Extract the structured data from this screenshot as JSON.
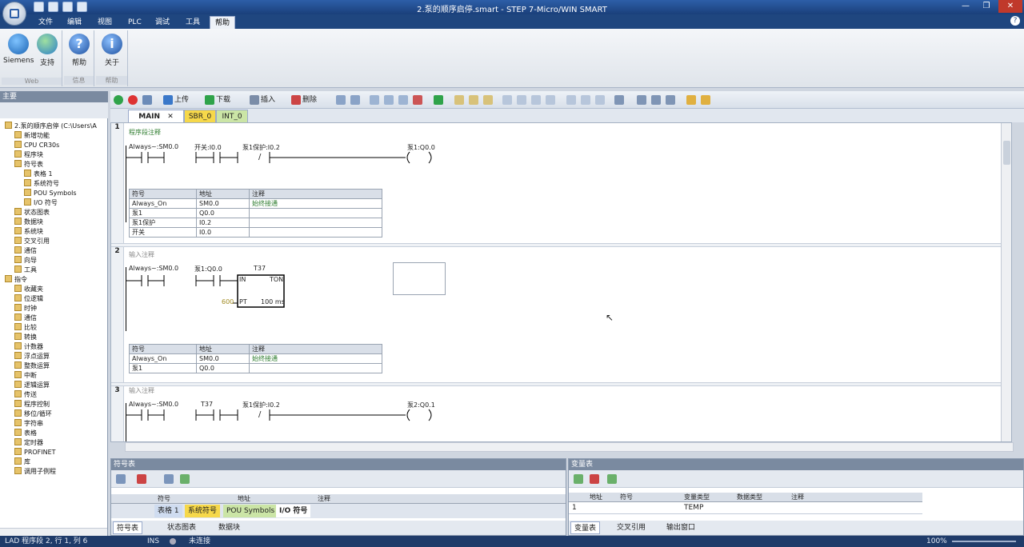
{
  "window": {
    "title": "2.泵的顺序启停.smart - STEP 7-Micro/WIN SMART",
    "buttons": [
      "—",
      "❐",
      "✕"
    ]
  },
  "menu": [
    "文件",
    "编辑",
    "视图",
    "PLC",
    "调试",
    "工具",
    "帮助"
  ],
  "ribbon": {
    "groups": [
      {
        "label": "Web",
        "buttons": [
          "Siemens",
          "支持"
        ]
      },
      {
        "label": "信息",
        "buttons": [
          "帮助"
        ]
      },
      {
        "label": "帮助",
        "buttons": [
          "关于"
        ]
      }
    ]
  },
  "left_panel": {
    "title": "主要",
    "tree": [
      "2.泵的顺序启停 (C:\\Users\\A",
      "新增功能",
      "CPU CR30s",
      "程序块",
      "符号表",
      "表格 1",
      "系统符号",
      "POU Symbols",
      "I/O 符号",
      "状态图表",
      "数据块",
      "系统块",
      "交叉引用",
      "通信",
      "向导",
      "工具",
      "指令",
      "收藏夹",
      "位逻辑",
      "时钟",
      "通信",
      "比较",
      "转换",
      "计数器",
      "浮点运算",
      "整数运算",
      "中断",
      "逻辑运算",
      "传送",
      "程序控制",
      "移位/循环",
      "字符串",
      "表格",
      "定时器",
      "PROFINET",
      "库",
      "调用子例程"
    ]
  },
  "toolbar": {
    "upload": "上传",
    "download": "下载",
    "insert": "插入",
    "delete": "删除"
  },
  "tabs": [
    "MAIN",
    "SBR_0",
    "INT_0"
  ],
  "networks": [
    {
      "num": "1",
      "comment": "程序段注释",
      "ops": [
        "Always~:SM0.0",
        "开关:I0.0",
        "泵1保护:I0.2",
        "泵1:Q0.0"
      ],
      "slash": "/",
      "table": {
        "headers": [
          "符号",
          "地址",
          "注释"
        ],
        "rows": [
          [
            "Always_On",
            "SM0.0",
            "始终接通"
          ],
          [
            "泵1",
            "Q0.0",
            ""
          ],
          [
            "泵1保护",
            "I0.2",
            ""
          ],
          [
            "开关",
            "I0.0",
            ""
          ]
        ]
      }
    },
    {
      "num": "2",
      "comment": "输入注释",
      "ops": [
        "Always~:SM0.0",
        "泵1:Q0.0",
        "T37"
      ],
      "timer": {
        "in": "IN",
        "type": "TON",
        "pt": "PT",
        "pt_value": "600",
        "base": "100 ms"
      },
      "table": {
        "headers": [
          "符号",
          "地址",
          "注释"
        ],
        "rows": [
          [
            "Always_On",
            "SM0.0",
            "始终接通"
          ],
          [
            "泵1",
            "Q0.0",
            ""
          ]
        ]
      }
    },
    {
      "num": "3",
      "comment": "输入注释",
      "ops": [
        "Always~:SM0.0",
        "T37",
        "泵1保护:I0.2",
        "泵2:Q0.1"
      ],
      "slash": "/"
    }
  ],
  "symbol_panel": {
    "title": "符号表",
    "headers": [
      "符号",
      "地址",
      "注释"
    ],
    "sheet_tabs": [
      "表格 1",
      "系统符号",
      "POU Symbols",
      "I/O 符号"
    ],
    "bottom_tabs": [
      "符号表",
      "状态图表",
      "数据块"
    ]
  },
  "var_panel": {
    "title": "变量表",
    "headers": [
      "地址",
      "符号",
      "变量类型",
      "数据类型",
      "注释"
    ],
    "row": [
      "1",
      "",
      "TEMP"
    ],
    "bottom_tabs": [
      "变量表",
      "交叉引用",
      "输出窗口"
    ]
  },
  "status": {
    "position": "LAD 程序段 2, 行 1, 列 6",
    "mode": "INS",
    "conn": "未连接",
    "zoom": "100%"
  }
}
